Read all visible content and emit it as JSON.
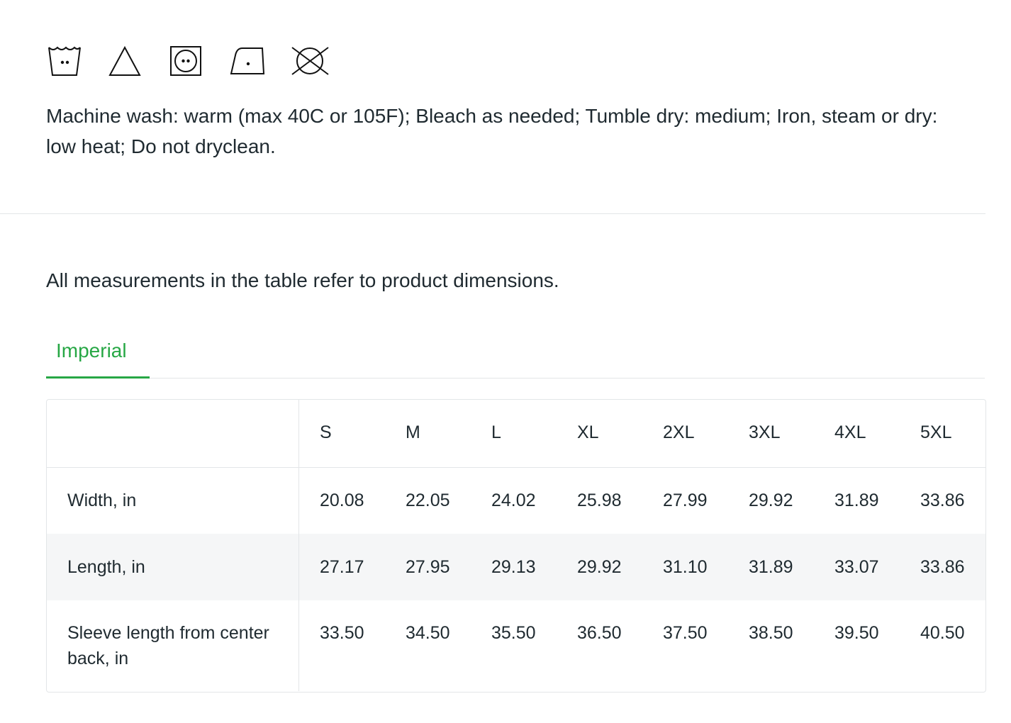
{
  "care": {
    "icons": [
      "machine-wash-warm-icon",
      "bleach-icon",
      "tumble-dry-medium-icon",
      "iron-low-icon",
      "do-not-dryclean-icon"
    ],
    "text": "Machine wash: warm (max 40C or 105F); Bleach as needed; Tumble dry: medium; Iron, steam or dry: low heat; Do not dryclean."
  },
  "measurements": {
    "note": "All measurements in the table refer to product dimensions.",
    "tabs": [
      {
        "label": "Imperial",
        "active": true
      }
    ],
    "accent_color": "#27a745",
    "columns": [
      "",
      "S",
      "M",
      "L",
      "XL",
      "2XL",
      "3XL",
      "4XL",
      "5XL"
    ],
    "rows": [
      {
        "label": "Width, in",
        "values": [
          "20.08",
          "22.05",
          "24.02",
          "25.98",
          "27.99",
          "29.92",
          "31.89",
          "33.86"
        ]
      },
      {
        "label": "Length, in",
        "values": [
          "27.17",
          "27.95",
          "29.13",
          "29.92",
          "31.10",
          "31.89",
          "33.07",
          "33.86"
        ]
      },
      {
        "label": "Sleeve length from center back, in",
        "values": [
          "33.50",
          "34.50",
          "35.50",
          "36.50",
          "37.50",
          "38.50",
          "39.50",
          "40.50"
        ]
      }
    ]
  }
}
